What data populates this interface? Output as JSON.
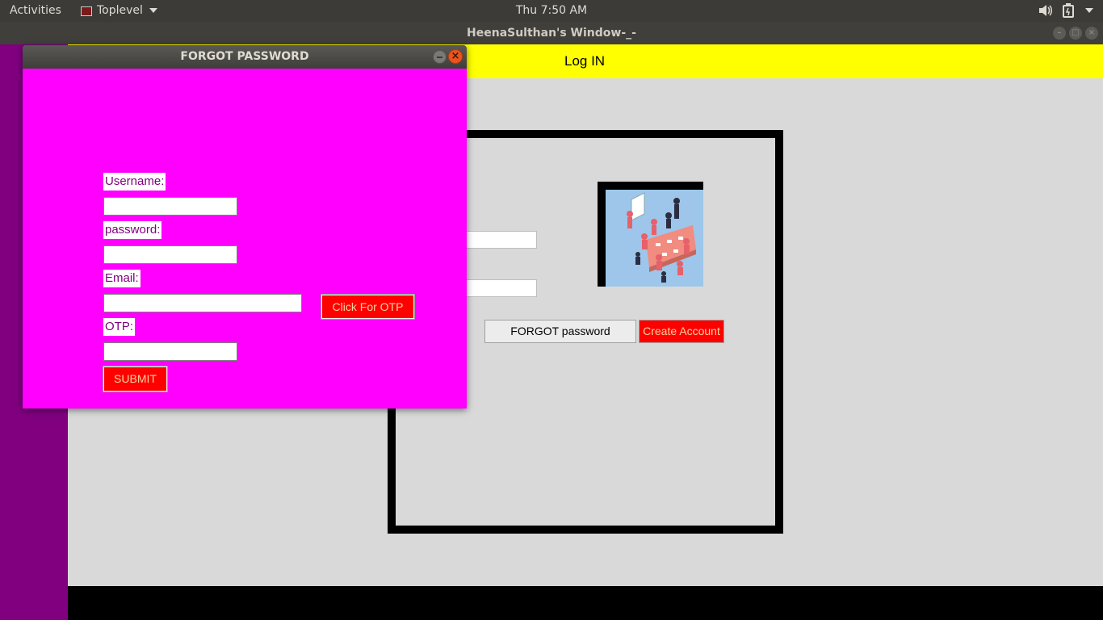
{
  "topbar": {
    "activities": "Activities",
    "app_name": "Toplevel",
    "clock": "Thu  7:50 AM",
    "icons": [
      "speaker-icon",
      "battery-icon",
      "system-menu-icon"
    ]
  },
  "main_window": {
    "title": "HeenaSulthan's Window-_-",
    "header": "Log IN",
    "buttons": {
      "forgot": "FORGOT password",
      "create": "Create Account"
    },
    "colors": {
      "sidebar": "#800080",
      "header": "#ffff00",
      "background": "#d9d9d9"
    },
    "image": "team-meeting-illustration"
  },
  "dialog": {
    "title": "FORGOT PASSWORD",
    "fields": {
      "username_label": "Username:",
      "username_value": "",
      "password_label": "password:",
      "password_value": "",
      "email_label": "Email:",
      "email_value": "",
      "otp_label": "OTP:",
      "otp_value": ""
    },
    "buttons": {
      "otp": "Click For OTP",
      "submit": "SUBMIT"
    },
    "colors": {
      "background": "#ff00ff",
      "button": "#ff0000",
      "label_text": "#800080"
    }
  }
}
